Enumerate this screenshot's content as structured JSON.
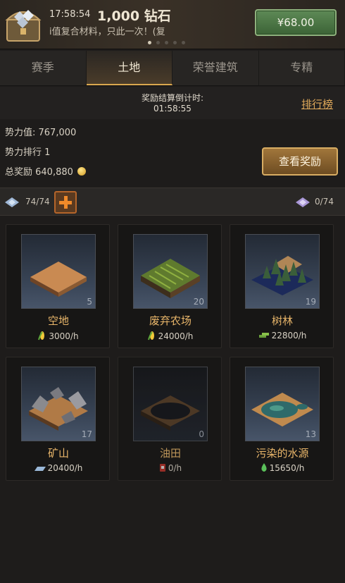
{
  "banner": {
    "time": "17:58:54",
    "gems": "1,000 钻石",
    "desc": "i值复合材料，只此一次！(复",
    "price": "¥68.00",
    "dots_active": 1,
    "dots_total": 5
  },
  "tabs": [
    {
      "label": "赛季",
      "active": false
    },
    {
      "label": "土地",
      "active": true
    },
    {
      "label": "荣誉建筑",
      "active": false
    },
    {
      "label": "专精",
      "active": false
    }
  ],
  "countdown": {
    "label": "奖励结算倒计时:",
    "time": "01:58:55",
    "rank_link": "排行榜"
  },
  "stats": {
    "power": "势力值: 767,000",
    "rank": "势力排行  1",
    "reward": "总奖励  640,880"
  },
  "reward_button": "查看奖励",
  "landbar": {
    "left_count": "74/74",
    "right_count": "0/74"
  },
  "cards": [
    {
      "name": "空地",
      "count": "5",
      "rate": "3000/h",
      "resource_icon": "corn-icon"
    },
    {
      "name": "废弃农场",
      "count": "20",
      "rate": "24000/h",
      "resource_icon": "corn-icon"
    },
    {
      "name": "树林",
      "count": "19",
      "rate": "22800/h",
      "resource_icon": "wood-icon"
    },
    {
      "name": "矿山",
      "count": "17",
      "rate": "20400/h",
      "resource_icon": "metal-icon"
    },
    {
      "name": "油田",
      "count": "0",
      "rate": "0/h",
      "resource_icon": "oil-icon"
    },
    {
      "name": "污染的水源",
      "count": "13",
      "rate": "15650/h",
      "resource_icon": "water-icon"
    }
  ],
  "colors": {
    "accent_gold": "#e9b66a",
    "price_green": "#3c6336",
    "tab_underline": "#d9a74f"
  }
}
